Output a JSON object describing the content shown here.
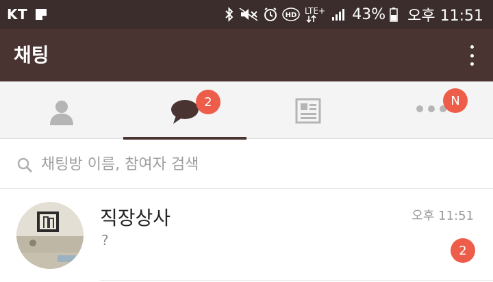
{
  "status_bar": {
    "carrier": "KT",
    "network": "LTE+",
    "battery": "43%",
    "time": "오후 11:51",
    "icons": [
      "note-icon",
      "bluetooth-icon",
      "mute-icon",
      "alarm-icon",
      "hd-icon",
      "lte-icon",
      "signal-icon",
      "battery-icon"
    ]
  },
  "app_bar": {
    "title": "채팅",
    "menu_icon": "more-vertical-icon"
  },
  "tabs": [
    {
      "id": "friends",
      "icon": "person-icon",
      "badge": "",
      "active": false
    },
    {
      "id": "chats",
      "icon": "chat-bubble-icon",
      "badge": "2",
      "active": true
    },
    {
      "id": "feed",
      "icon": "news-icon",
      "badge": "",
      "active": false
    },
    {
      "id": "more",
      "icon": "more-horizontal-icon",
      "badge": "N",
      "active": false
    }
  ],
  "search": {
    "placeholder": "채팅방 이름, 참여자 검색",
    "value": ""
  },
  "chats": [
    {
      "name": "직장상사",
      "preview": "?",
      "time": "오후 11:51",
      "unread": "2"
    }
  ],
  "colors": {
    "status_bar": "#3a2d2c",
    "app_bar": "#4a3432",
    "badge": "#ee5d4a",
    "tab_bar": "#f4f4f4"
  }
}
